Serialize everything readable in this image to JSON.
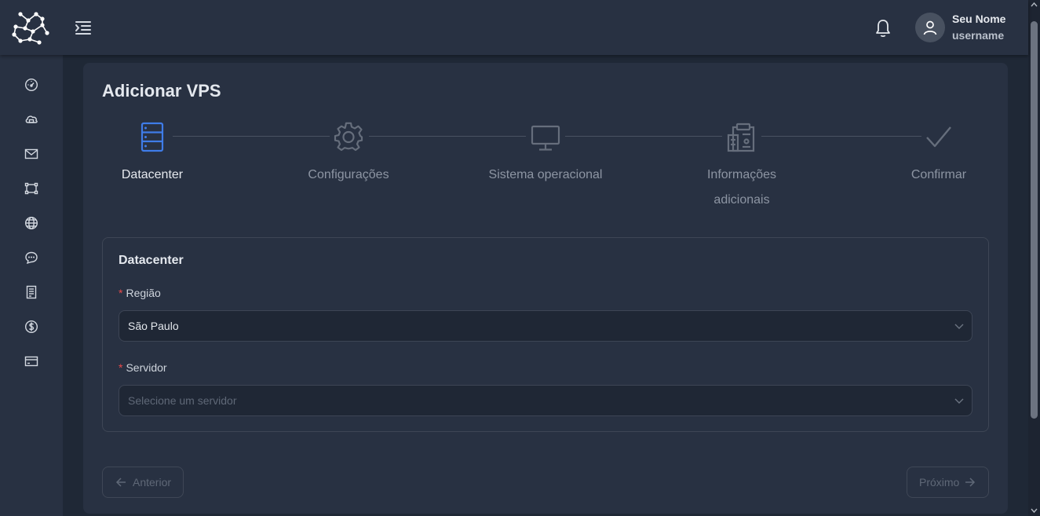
{
  "header": {
    "user_name": "Seu Nome",
    "user_login": "username",
    "icons": [
      "logo",
      "menu-toggle-icon",
      "bell-icon",
      "user-icon"
    ]
  },
  "sidebar": {
    "items": [
      {
        "icon": "dashboard-icon"
      },
      {
        "icon": "cloud-icon"
      },
      {
        "icon": "mail-icon"
      },
      {
        "icon": "network-icon"
      },
      {
        "icon": "globe-icon"
      },
      {
        "icon": "chat-icon"
      },
      {
        "icon": "document-icon"
      },
      {
        "icon": "dollar-icon"
      },
      {
        "icon": "credit-card-icon"
      }
    ]
  },
  "page": {
    "title": "Adicionar VPS"
  },
  "steps": [
    {
      "label": "Datacenter",
      "icon": "server-icon",
      "active": true
    },
    {
      "label": "Configurações",
      "icon": "gear-icon",
      "active": false
    },
    {
      "label": "Sistema operacional",
      "icon": "monitor-icon",
      "active": false
    },
    {
      "label": "Informações adicionais",
      "icon": "clipboard-icon",
      "active": false
    },
    {
      "label": "Confirmar",
      "icon": "check-icon",
      "active": false
    }
  ],
  "form": {
    "section_title": "Datacenter",
    "regiao_label": "Região",
    "regiao_value": "São Paulo",
    "servidor_label": "Servidor",
    "servidor_placeholder": "Selecione um servidor",
    "required_mark": "*"
  },
  "buttons": {
    "prev_label": "Anterior",
    "next_label": "Próximo"
  },
  "colors": {
    "accent": "#3f7ce8",
    "required": "#e84a4a",
    "background": "#1f2836",
    "panel": "#283142"
  }
}
